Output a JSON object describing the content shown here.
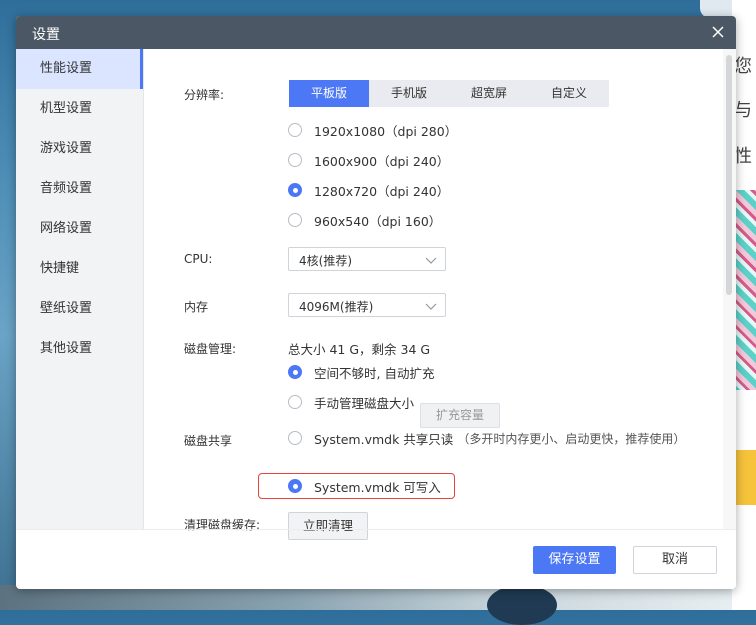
{
  "background": {
    "right_texts": [
      "您",
      "与",
      "性"
    ]
  },
  "dialog": {
    "title": "设置",
    "close_icon": "close-icon",
    "sidebar": {
      "items": [
        {
          "label": "性能设置",
          "active": true
        },
        {
          "label": "机型设置"
        },
        {
          "label": "游戏设置"
        },
        {
          "label": "音频设置"
        },
        {
          "label": "网络设置"
        },
        {
          "label": "快捷键"
        },
        {
          "label": "壁纸设置"
        },
        {
          "label": "其他设置"
        }
      ]
    },
    "resolution": {
      "label": "分辨率:",
      "tabs": [
        "平板版",
        "手机版",
        "超宽屏",
        "自定义"
      ],
      "active_tab": "平板版",
      "options": [
        {
          "label": "1920x1080（dpi 280）",
          "checked": false
        },
        {
          "label": "1600x900（dpi 240）",
          "checked": false
        },
        {
          "label": "1280x720（dpi 240）",
          "checked": true
        },
        {
          "label": "960x540（dpi 160）",
          "checked": false
        }
      ]
    },
    "cpu": {
      "label": "CPU:",
      "value": "4核(推荐)"
    },
    "memory": {
      "label": "内存",
      "value": "4096M(推荐)"
    },
    "disk": {
      "label": "磁盘管理:",
      "summary": "总大小 41 G，剩余 34 G",
      "options": [
        {
          "label": "空间不够时, 自动扩充",
          "checked": true
        },
        {
          "label": "手动管理磁盘大小",
          "checked": false
        }
      ],
      "expand_button": "扩充容量"
    },
    "disk_share": {
      "label": "磁盘共享",
      "options": [
        {
          "label": "System.vmdk 共享只读",
          "note": "（多开时内存更小、启动更快，推荐使用）",
          "checked": false
        },
        {
          "label": "System.vmdk 可写入",
          "checked": true
        }
      ],
      "highlight_color": "#e3453e"
    },
    "cache": {
      "label": "清理磁盘缓存:",
      "button": "立即清理"
    },
    "footer": {
      "save": "保存设置",
      "cancel": "取消"
    },
    "colors": {
      "accent": "#4d78f5",
      "titlebar": "#4c5766",
      "sidebar_bg": "#f2f3f5",
      "active_item_bg": "#dbe5ff"
    }
  }
}
